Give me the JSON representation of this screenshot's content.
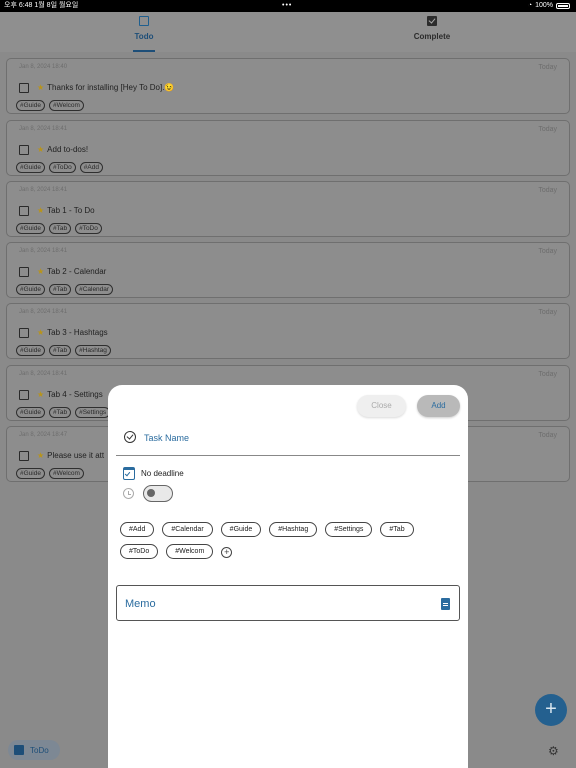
{
  "status_bar": {
    "time": "오후 6:48",
    "date": "1월 8일 월요일",
    "dots": "•••",
    "battery": "100%"
  },
  "tabs": [
    {
      "label": "Todo",
      "active": true
    },
    {
      "label": "Complete",
      "active": false
    }
  ],
  "todos": [
    {
      "date": "Jan 8, 2024 18:40",
      "today": "Today",
      "title": "Thanks for installing [Hey To Do].😉",
      "tags": [
        "#Guide",
        "#Welcom"
      ]
    },
    {
      "date": "Jan 8, 2024 18:41",
      "today": "Today",
      "title": "Add to-dos!",
      "tags": [
        "#Guide",
        "#ToDo",
        "#Add"
      ]
    },
    {
      "date": "Jan 8, 2024 18:41",
      "today": "Today",
      "title": "Tab 1 - To Do",
      "tags": [
        "#Guide",
        "#Tab",
        "#ToDo"
      ]
    },
    {
      "date": "Jan 8, 2024 18:41",
      "today": "Today",
      "title": "Tab 2 - Calendar",
      "tags": [
        "#Guide",
        "#Tab",
        "#Calendar"
      ]
    },
    {
      "date": "Jan 8, 2024 18:41",
      "today": "Today",
      "title": "Tab 3 - Hashtags",
      "tags": [
        "#Guide",
        "#Tab",
        "#Hashtag"
      ]
    },
    {
      "date": "Jan 8, 2024 18:41",
      "today": "Today",
      "title": "Tab 4 - Settings",
      "tags": [
        "#Guide",
        "#Tab",
        "#Settings"
      ]
    },
    {
      "date": "Jan 8, 2024 18:47",
      "today": "Today",
      "title": "Please use it att",
      "tags": [
        "#Guide",
        "#Welcom"
      ]
    }
  ],
  "bottom": {
    "filter_label": "ToDo"
  },
  "modal": {
    "close_label": "Close",
    "add_label": "Add",
    "task_placeholder": "Task Name",
    "deadline_label": "No deadline",
    "alarm_enabled": false,
    "hashtags": [
      "#Add",
      "#Calendar",
      "#Guide",
      "#Hashtag",
      "#Settings",
      "#Tab",
      "#ToDo",
      "#Welcom"
    ],
    "memo_label": "Memo"
  },
  "colors": {
    "accent": "#2b6c9f",
    "dim_overlay": "#8a8a8a",
    "fab": "#24608f"
  }
}
